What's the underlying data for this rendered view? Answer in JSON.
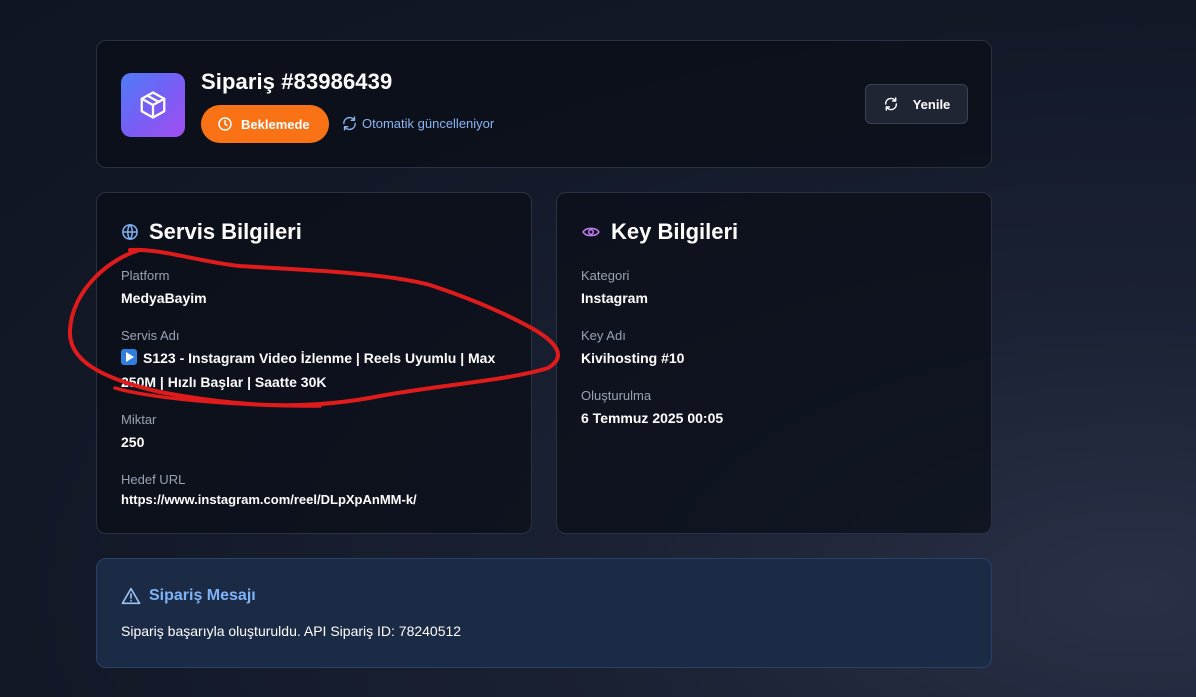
{
  "order": {
    "title": "Sipariş #83986439",
    "status": "Beklemede",
    "auto_update": "Otomatik güncelleniyor",
    "refresh_label": "Yenile"
  },
  "service": {
    "heading": "Servis Bilgileri",
    "platform_label": "Platform",
    "platform_value": "MedyaBayim",
    "service_name_label": "Servis Adı",
    "service_name_value": "S123 - Instagram Video İzlenme | Reels Uyumlu | Max 250M | Hızlı Başlar | Saatte 30K",
    "quantity_label": "Miktar",
    "quantity_value": "250",
    "target_url_label": "Hedef URL",
    "target_url_value": "https://www.instagram.com/reel/DLpXpAnMM-k/"
  },
  "key": {
    "heading": "Key Bilgileri",
    "category_label": "Kategori",
    "category_value": "Instagram",
    "key_name_label": "Key Adı",
    "key_name_value": "Kivihosting #10",
    "created_label": "Oluşturulma",
    "created_value": "6 Temmuz 2025 00:05"
  },
  "message": {
    "title": "Sipariş Mesajı",
    "text": "Sipariş başarıyla oluşturuldu. API Sipariş ID: 78240512"
  },
  "colors": {
    "status_orange": "#f97316",
    "accent_blue": "#7fb3f5",
    "annotation_red": "#e01b1b"
  },
  "icons": {
    "logo": "box-icon",
    "status": "clock-icon",
    "auto_update": "sync-icon",
    "refresh": "refresh-icon",
    "service_heading": "globe-icon",
    "key_heading": "eye-icon",
    "service_item": "play-icon",
    "message": "warning-icon"
  }
}
